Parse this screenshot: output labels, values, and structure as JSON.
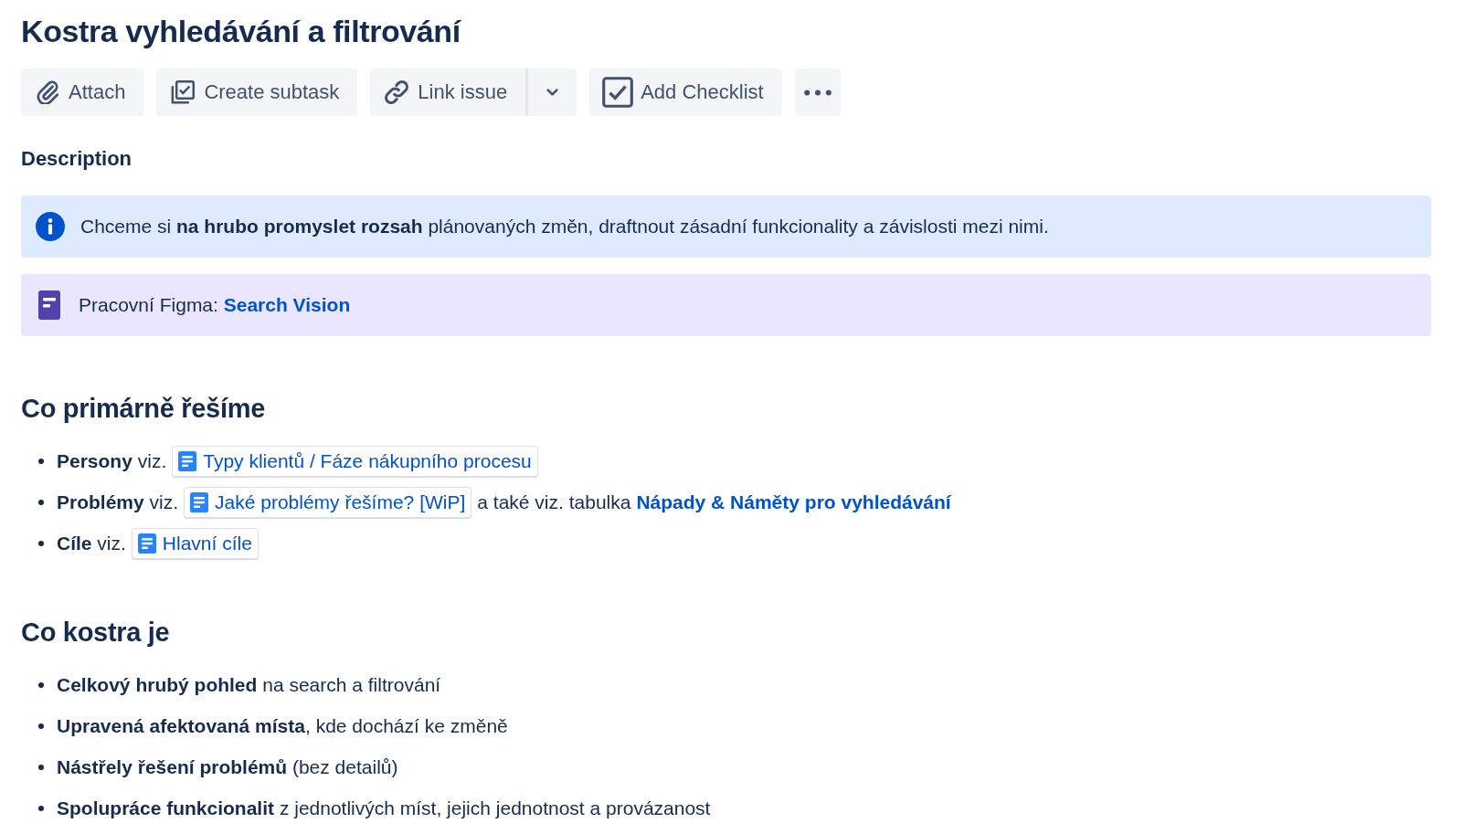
{
  "issue": {
    "title": "Kostra vyhledávání a filtrování"
  },
  "toolbar": [
    {
      "kind": "attach",
      "label": "Attach"
    },
    {
      "kind": "subtask",
      "label": "Create subtask"
    },
    {
      "kind": "link",
      "label": "Link issue"
    },
    {
      "kind": "caret"
    },
    {
      "kind": "checklist",
      "label": "Add Checklist"
    },
    {
      "kind": "more"
    }
  ],
  "description": {
    "label": "Description",
    "panels": [
      {
        "kind": "info",
        "text": "Chceme si **na hrubo promyslet rozsah** plánovaných změn, draftnout zásadní funkcionality a závislosti mezi nimi."
      },
      {
        "kind": "note",
        "text": "Pracovní Figma:",
        "link": "Search Vision"
      }
    ],
    "sections": [
      {
        "heading": "Co primárně řešíme",
        "items": [
          {
            "text": "**Persony** viz.",
            "card": "Typy klientů / Fáze nákupního procesu"
          },
          {
            "text": "**Problémy** viz.",
            "card": "Jaké problémy řešíme? [WiP]",
            "after": "a také viz. tabulka",
            "link": "Nápady & Náměty pro vyhledávání"
          },
          {
            "text": "**Cíle** viz.",
            "card": "Hlavní cíle"
          }
        ]
      },
      {
        "heading": "Co kostra je",
        "items": [
          {
            "text": "**Celkový hrubý pohled** na search a filtrování"
          },
          {
            "text": "**Upravená afektovaná místa**, kde dochází ke změně"
          },
          {
            "text": "**Nástřely řešení problémů** (bez detailů)"
          },
          {
            "text": "**Spolupráce funkcionalit** z jednotlivých míst, jejich jednotnost a provázanost"
          }
        ]
      }
    ]
  }
}
